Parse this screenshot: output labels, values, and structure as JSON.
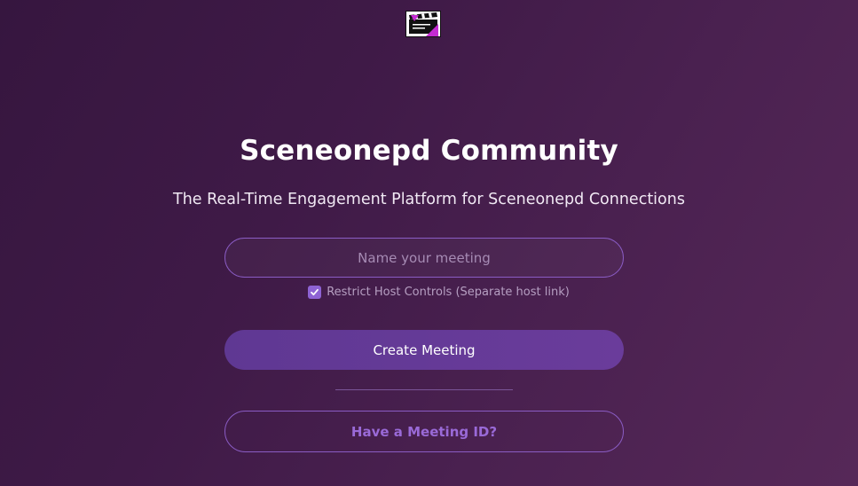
{
  "logo": {
    "icon": "clapperboard-icon"
  },
  "header": {
    "title": "Sceneonepd Community",
    "subtitle": "The Real-Time Engagement Platform for Sceneonepd Connections"
  },
  "form": {
    "meeting_name_placeholder": "Name your meeting",
    "meeting_name_value": "",
    "restrict_label": "Restrict Host Controls (Separate host link)",
    "restrict_checked": true,
    "create_label": "Create Meeting",
    "have_id_label": "Have a Meeting ID?"
  },
  "colors": {
    "accent": "#8e63d4",
    "button": "#663a98",
    "background_start": "#36163f",
    "background_end": "#562858"
  }
}
